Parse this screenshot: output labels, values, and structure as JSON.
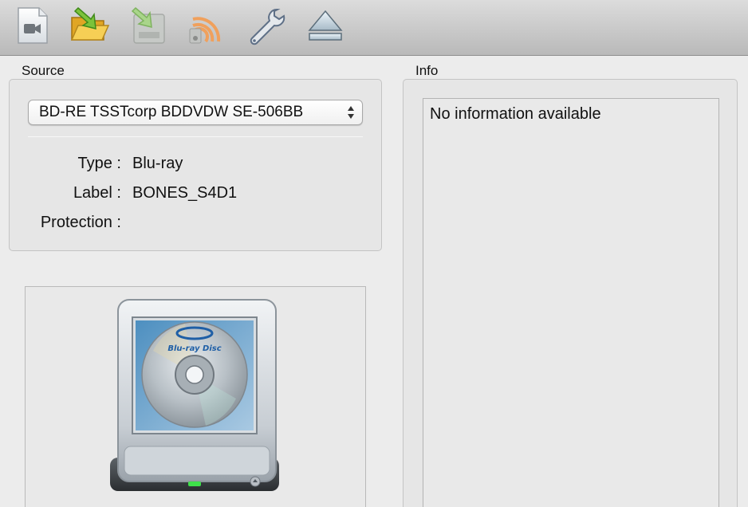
{
  "toolbar": {
    "buttons": [
      {
        "icon": "video-icon"
      },
      {
        "icon": "open-folder-icon"
      },
      {
        "icon": "import-disk-icon"
      },
      {
        "icon": "stream-icon"
      },
      {
        "icon": "wrench-icon"
      },
      {
        "icon": "eject-icon"
      }
    ]
  },
  "source": {
    "title": "Source",
    "drive": "BD-RE TSSTcorp BDDVDW SE-506BB",
    "type_label": "Type :",
    "type_value": "Blu-ray",
    "label_label": "Label :",
    "label_value": "BONES_S4D1",
    "protection_label": "Protection :",
    "protection_value": ""
  },
  "info": {
    "title": "Info",
    "text": "No information available"
  },
  "drive_image": {
    "logo_text": "Blu-ray Disc",
    "led_color": "#3ee04a"
  }
}
